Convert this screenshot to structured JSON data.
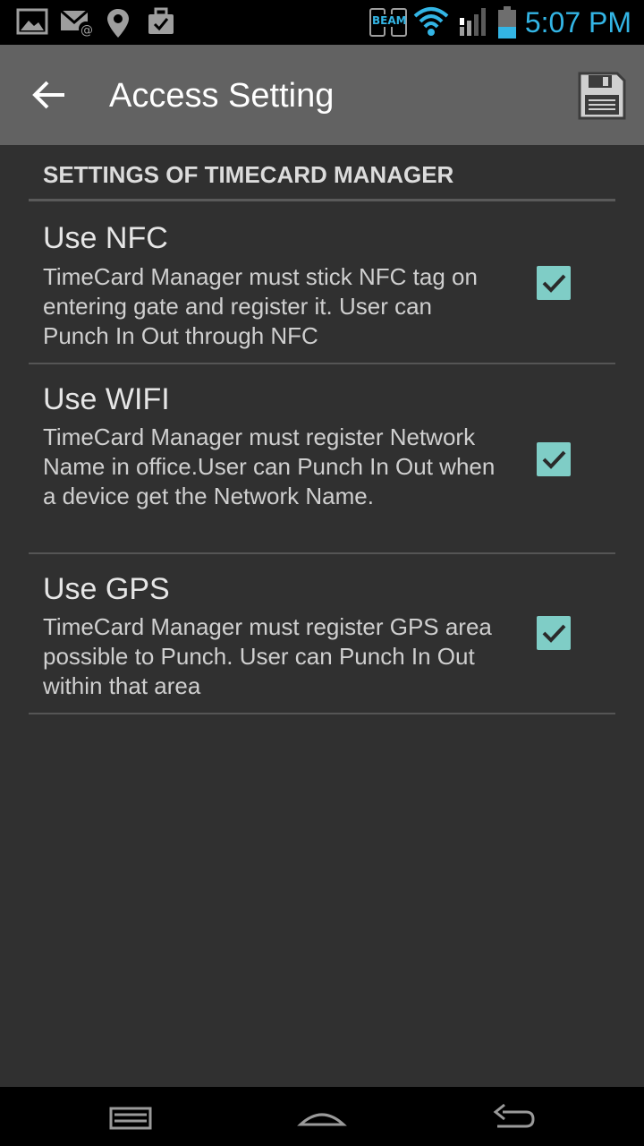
{
  "status_bar": {
    "time": "5:07 PM",
    "beam_label": "BEAM",
    "icons": [
      "image-icon",
      "email-icon",
      "location-pin-icon",
      "briefcase-icon",
      "beam-icon",
      "wifi-icon",
      "signal-icon",
      "battery-icon"
    ],
    "time_color": "#33b5e5"
  },
  "action_bar": {
    "title": "Access Setting",
    "back_icon": "arrow-left-icon",
    "save_icon": "floppy-disk-icon"
  },
  "section": {
    "header": "SETTINGS OF TIMECARD MANAGER"
  },
  "preferences": [
    {
      "title": "Use NFC",
      "summary": "TimeCard Manager must stick NFC tag on entering gate and register it. User can Punch In Out through NFC",
      "checked": true
    },
    {
      "title": "Use WIFI",
      "summary": "TimeCard Manager must register Network Name in office.User can Punch In Out when a device get the Network Name.",
      "checked": true
    },
    {
      "title": "Use GPS",
      "summary": "TimeCard Manager must register GPS area possible to Punch. User can Punch In Out within that area",
      "checked": true
    }
  ],
  "colors": {
    "accent_check": "#7fcdc6",
    "action_bar": "#626262",
    "background": "#303030"
  },
  "nav_bar": {
    "icons": [
      "recent-apps-icon",
      "home-icon",
      "back-icon"
    ]
  }
}
